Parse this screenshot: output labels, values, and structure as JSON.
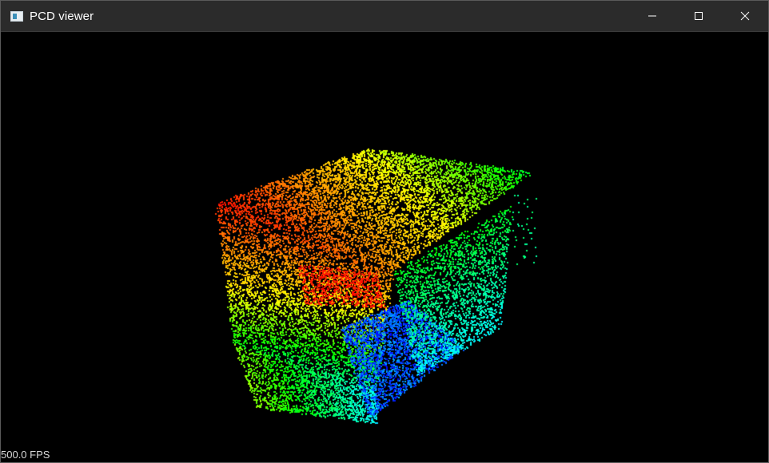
{
  "window": {
    "title": "PCD viewer",
    "icon": "app-window-icon",
    "controls": {
      "minimize": "minimize-icon",
      "maximize": "maximize-icon",
      "close": "close-icon"
    }
  },
  "viewer": {
    "background": "#000000",
    "fps_label": "500.0 FPS",
    "colormap": [
      "#ff0000",
      "#ff8000",
      "#ffff00",
      "#00ff00",
      "#00ffff",
      "#0000ff"
    ]
  }
}
